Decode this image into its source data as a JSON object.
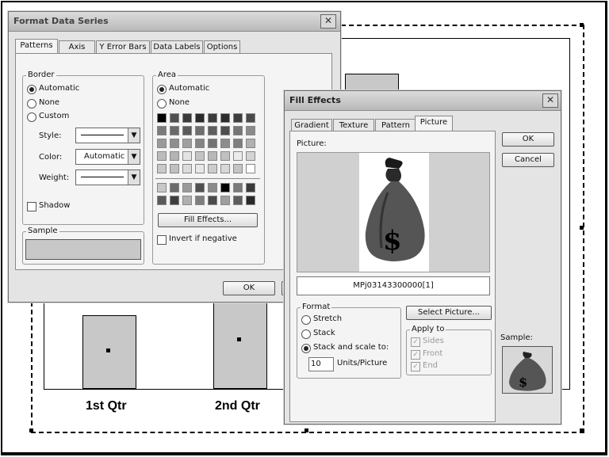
{
  "chart": {
    "categories": [
      "1st Qtr",
      "2nd Qtr"
    ]
  },
  "format_dialog": {
    "title": "Format Data Series",
    "tabs": [
      "Patterns",
      "Axis",
      "Y Error Bars",
      "Data Labels",
      "Options"
    ],
    "border": {
      "group_label": "Border",
      "options": [
        "Automatic",
        "None",
        "Custom"
      ],
      "selected": "Automatic",
      "style_label": "Style:",
      "color_label": "Color:",
      "color_value": "Automatic",
      "weight_label": "Weight:",
      "shadow_label": "Shadow"
    },
    "area": {
      "group_label": "Area",
      "options": [
        "Automatic",
        "None"
      ],
      "selected": "Automatic",
      "fill_effects_label": "Fill Effects...",
      "invert_label": "Invert if negative"
    },
    "sample_label": "Sample",
    "ok_label": "OK",
    "palette_colors": [
      "#000000",
      "#505050",
      "#3a3a3a",
      "#2a2a2a",
      "#3c3c3c",
      "#2c2c2c",
      "#3e3e3e",
      "#4a4a4a",
      "#7a7a7a",
      "#6a6a6a",
      "#5a5a5a",
      "#6e6e6e",
      "#5e5e5e",
      "#4e4e4e",
      "#767676",
      "#8a8a8a",
      "#9a9a9a",
      "#8e8e8e",
      "#a0a0a0",
      "#848484",
      "#727272",
      "#8c8c8c",
      "#7e7e7e",
      "#b0b0b0",
      "#bcbcbc",
      "#b4b4b4",
      "#e4e4e4",
      "#c4c4c4",
      "#b8b8b8",
      "#c0c0c0",
      "#ececec",
      "#d4d4d4",
      "#c8c8c8",
      "#c0c0c0",
      "#dcdcdc",
      "#e8e8e8",
      "#cccccc",
      "#d8d8d8",
      "#c4c4c4",
      "#ffffff"
    ],
    "custom_colors": [
      "#c8c8c8",
      "#6a6a6a",
      "#9a9a9a",
      "#505050",
      "#8a8a8a",
      "#000000",
      "#7a7a7a",
      "#3a3a3a",
      "#5a5a5a",
      "#3e3e3e",
      "#b0b0b0",
      "#7e7e7e",
      "#4a4a4a",
      "#9e9e9e",
      "#5e5e5e",
      "#2a2a2a"
    ]
  },
  "fill_dialog": {
    "title": "Fill Effects",
    "tabs": [
      "Gradient",
      "Texture",
      "Pattern",
      "Picture"
    ],
    "picture_label": "Picture:",
    "filename": "MPj03143300000[1]",
    "format": {
      "group_label": "Format",
      "options": [
        "Stretch",
        "Stack",
        "Stack and scale to:"
      ],
      "selected": "Stack and scale to:",
      "units_value": "10",
      "units_label": "Units/Picture"
    },
    "select_picture_label": "Select Picture...",
    "apply_to": {
      "group_label": "Apply to",
      "options": [
        "Sides",
        "Front",
        "End"
      ]
    },
    "sample_label": "Sample:",
    "ok_label": "OK",
    "cancel_label": "Cancel"
  }
}
